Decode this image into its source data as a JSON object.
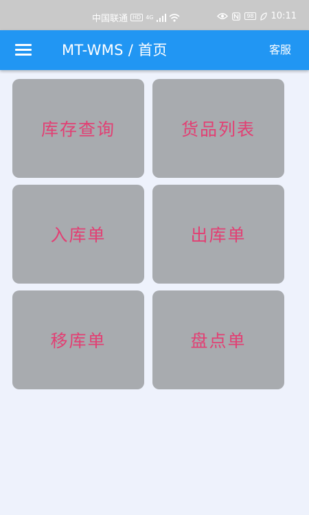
{
  "status_bar": {
    "carrier": "中国联通",
    "hd_badge": "HD",
    "network": "4G",
    "battery": "98",
    "time": "10:11",
    "icons": [
      "signal-icon",
      "wifi-icon",
      "eye-icon",
      "nfc-icon",
      "battery-icon",
      "leaf-icon"
    ]
  },
  "app_bar": {
    "title": "MT-WMS / 首页",
    "service_label": "客服",
    "menu_icon": "menu-icon"
  },
  "tiles": [
    {
      "label": "库存查询"
    },
    {
      "label": "货品列表"
    },
    {
      "label": "入库单"
    },
    {
      "label": "出库单"
    },
    {
      "label": "移库单"
    },
    {
      "label": "盘点单"
    }
  ],
  "colors": {
    "app_bar": "#2196f3",
    "tile_background": "#a8abaf",
    "tile_text": "#e23f73",
    "page_background": "#eef2fc",
    "status_bar": "#c9c9c9"
  }
}
